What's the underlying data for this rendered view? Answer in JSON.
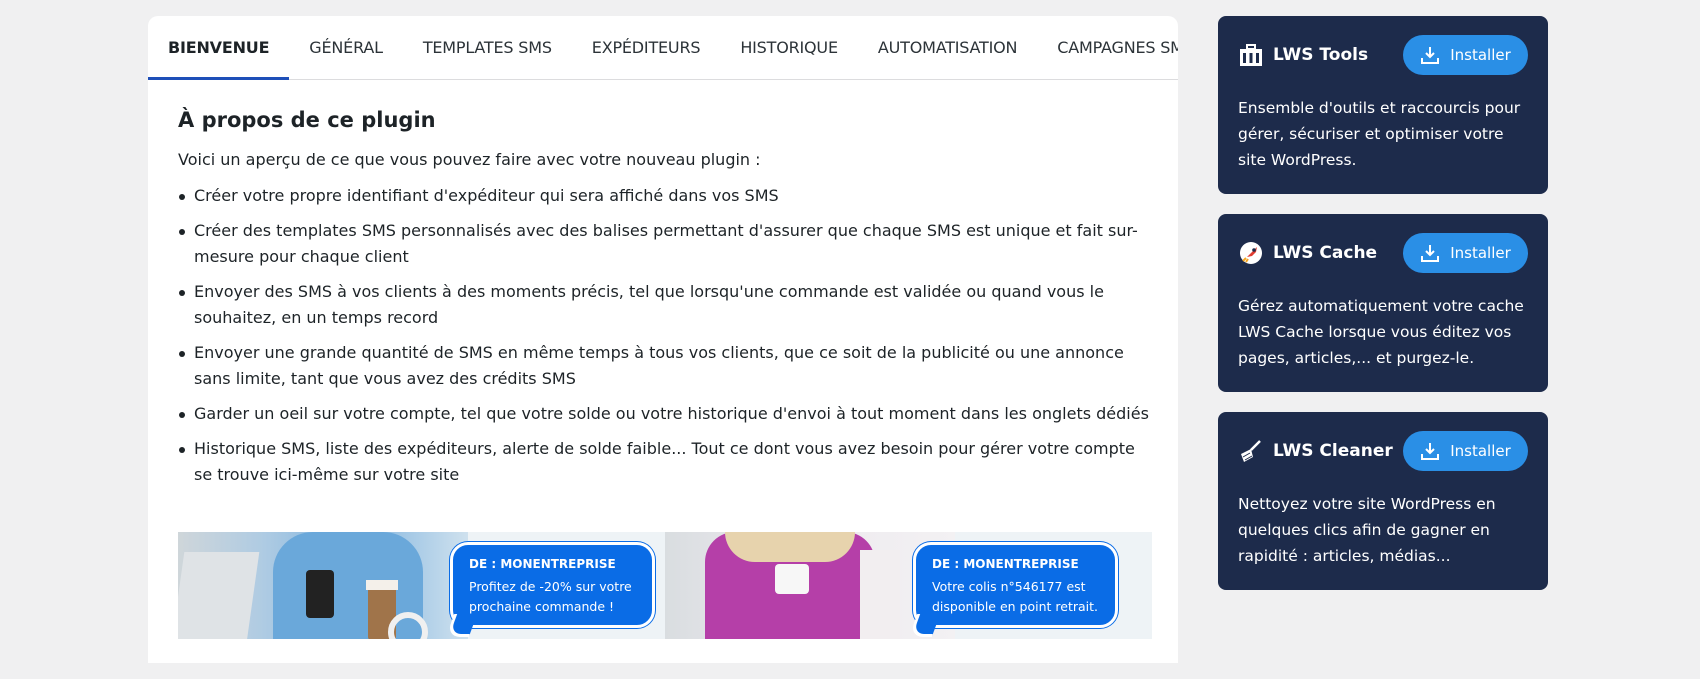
{
  "tabs": [
    {
      "label": "BIENVENUE",
      "active": true
    },
    {
      "label": "GÉNÉRAL",
      "active": false
    },
    {
      "label": "TEMPLATES SMS",
      "active": false
    },
    {
      "label": "EXPÉDITEURS",
      "active": false
    },
    {
      "label": "HISTORIQUE",
      "active": false
    },
    {
      "label": "AUTOMATISATION",
      "active": false
    },
    {
      "label": "CAMPAGNES SMS",
      "active": false
    }
  ],
  "about": {
    "title": "À propos de ce plugin",
    "intro": "Voici un aperçu de ce que vous pouvez faire avec votre nouveau plugin :",
    "features": [
      "Créer votre propre identifiant d'expéditeur qui sera affiché dans vos SMS",
      "Créer des templates SMS personnalisés avec des balises permettant d'assurer que chaque SMS est unique et fait sur-mesure pour chaque client",
      "Envoyer des SMS à vos clients à des moments précis, tel que lorsqu'une commande est validée ou quand vous le souhaitez, en un temps record",
      "Envoyer une grande quantité de SMS en même temps à tous vos clients, que ce soit de la publicité ou une annonce sans limite, tant que vous avez des crédits SMS",
      "Garder un oeil sur votre compte, tel que votre solde ou votre historique d'envoi à tout moment dans les onglets dédiés",
      "Historique SMS, liste des expéditeurs, alerte de solde faible... Tout ce dont vous avez besoin pour gérer votre compte se trouve ici-même sur votre site"
    ]
  },
  "banner": {
    "left": {
      "from": "DE : MONENTREPRISE",
      "message": "Profitez de -20% sur votre prochaine commande !"
    },
    "right": {
      "from": "DE : MONENTREPRISE",
      "message": "Votre colis n°546177 est disponible en point retrait."
    }
  },
  "sidebar": {
    "tools": [
      {
        "name": "LWS Tools",
        "icon": "toolbox-icon",
        "button": "Installer",
        "description": "Ensemble d'outils et raccourcis pour gérer, sécuriser et optimiser votre site WordPress."
      },
      {
        "name": "LWS Cache",
        "icon": "rocket-icon",
        "button": "Installer",
        "description": "Gérez automatiquement votre cache LWS Cache lorsque vous éditez vos pages, articles,... et purgez-le."
      },
      {
        "name": "LWS Cleaner",
        "icon": "broom-icon",
        "button": "Installer",
        "description": "Nettoyez votre site WordPress en quelques clics afin de gagner en rapidité : articles, médias..."
      }
    ]
  },
  "colors": {
    "accent": "#1e4fb8",
    "sidebar_card": "#1d2b4b",
    "install_button": "#2a8fe6",
    "bubble": "#0a6ce6"
  }
}
